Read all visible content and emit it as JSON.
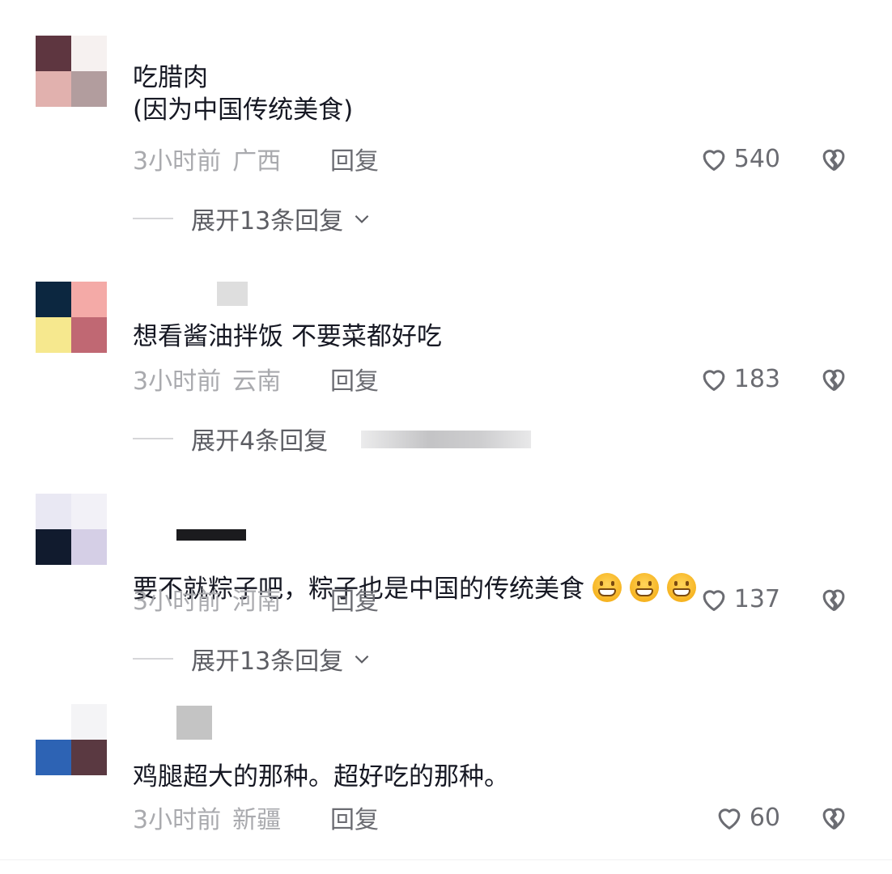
{
  "comments": [
    {
      "avatar_colors": [
        "#5e3640",
        "#f6f1f0",
        "#e1b1ae",
        "#b29d9e"
      ],
      "username": "",
      "text": "吃腊肉\n(因为中国传统美食)",
      "time": "3小时前",
      "location": "广西",
      "reply_label": "回复",
      "likes": "540",
      "expand_label": "展开13条回复",
      "expand_chevron": "chevron-down-icon"
    },
    {
      "avatar_colors": [
        "#0c2740",
        "#f4aaa7",
        "#f6e88e",
        "#c06873"
      ],
      "username": "",
      "text": "想看酱油拌饭 不要菜都好吃",
      "time": "3小时前",
      "location": "云南",
      "reply_label": "回复",
      "likes": "183",
      "expand_label": "展开4条回复"
    },
    {
      "avatar_colors": [
        "#e9e8f3",
        "#f2f1f7",
        "#111b2e",
        "#d5cfe6"
      ],
      "username": "",
      "text": "要不就粽子吧，粽子也是中国的传统美食",
      "emoji": [
        "grimace-emoji",
        "grimace-emoji",
        "grimace-emoji"
      ],
      "time": "3小时前",
      "location": "河南",
      "reply_label": "回复",
      "likes": "137",
      "expand_label": "展开13条回复",
      "expand_chevron": "chevron-down-icon"
    },
    {
      "avatar_colors": [
        "#ffffff",
        "#f4f4f6",
        "#2d63b4",
        "#5a3941"
      ],
      "username": "",
      "text": "鸡腿超大的那种。超好吃的那种。",
      "time": "3小时前",
      "location": "新疆",
      "reply_label": "回复",
      "likes": "60"
    }
  ],
  "colors": {
    "text_primary": "#161823",
    "text_meta": "#a9aaae",
    "text_secondary": "#6b6c72"
  },
  "icons": {
    "like": "heart-outline-icon",
    "dislike": "broken-heart-icon"
  }
}
